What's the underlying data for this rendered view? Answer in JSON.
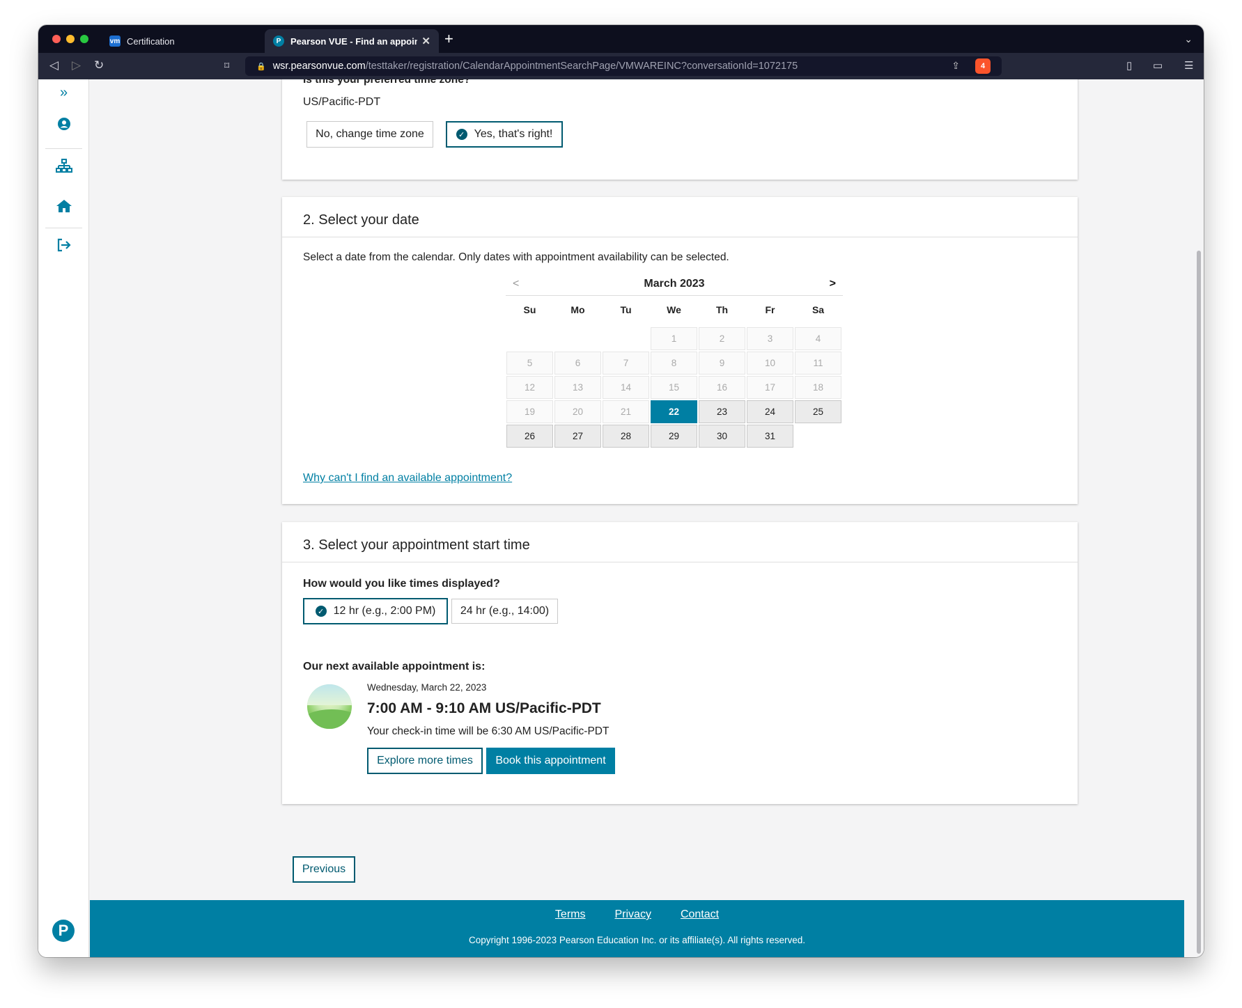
{
  "browser": {
    "tabs": [
      {
        "title": "Certification"
      },
      {
        "title": "Pearson VUE - Find an appointm"
      }
    ],
    "new_tab": "+",
    "url_domain": "wsr.pearsonvue.com",
    "url_path": "/testtaker/registration/CalendarAppointmentSearchPage/VMWAREINC?conversationId=1072175",
    "brave_badge": "4"
  },
  "timezone_section": {
    "question": "Is this your preferred time zone?",
    "value": "US/Pacific-PDT",
    "no_button": "No, change time zone",
    "yes_button": "Yes, that's right!"
  },
  "date_section": {
    "heading": "2. Select your date",
    "instruction": "Select a date from the calendar. Only dates with appointment availability can be selected.",
    "calendar": {
      "month": "March 2023",
      "prev": "<",
      "next": ">",
      "weekdays": [
        "Su",
        "Mo",
        "Tu",
        "We",
        "Th",
        "Fr",
        "Sa"
      ],
      "leading_blanks": 3,
      "days": [
        "1",
        "2",
        "3",
        "4",
        "5",
        "6",
        "7",
        "8",
        "9",
        "10",
        "11",
        "12",
        "13",
        "14",
        "15",
        "16",
        "17",
        "18",
        "19",
        "20",
        "21",
        "22",
        "23",
        "24",
        "25",
        "26",
        "27",
        "28",
        "29",
        "30",
        "31"
      ],
      "first_available": 22,
      "selected": 22
    },
    "help_link": "Why can't I find an available appointment?"
  },
  "time_section": {
    "heading": "3. Select your appointment start time",
    "format_question": "How would you like times displayed?",
    "format_12": "12 hr (e.g., 2:00 PM)",
    "format_24": "24 hr (e.g., 14:00)",
    "next_label": "Our next available appointment is:",
    "date": "Wednesday, March 22, 2023",
    "time_range": "7:00 AM - 9:10 AM US/Pacific-PDT",
    "checkin": "Your check-in time will be 6:30 AM US/Pacific-PDT",
    "explore_button": "Explore more times",
    "book_button": "Book this appointment"
  },
  "previous_button": "Previous",
  "footer": {
    "links": [
      "Terms",
      "Privacy",
      "Contact"
    ],
    "copyright": "Copyright 1996-2023 Pearson Education Inc. or its affiliate(s). All rights reserved."
  },
  "colors": {
    "accent": "#007fa3",
    "accent_dark": "#005a70",
    "footer_bg": "#007fa3"
  },
  "icons": {
    "sidebar": [
      "double-chevron-right-icon",
      "user-circle-icon",
      "sitemap-icon",
      "home-icon",
      "sign-out-icon"
    ],
    "logo": "pearson-logo"
  }
}
